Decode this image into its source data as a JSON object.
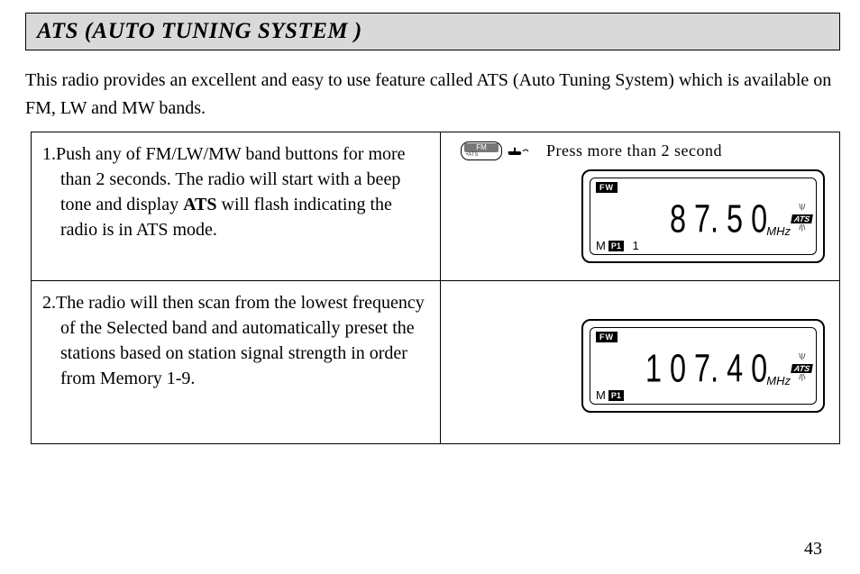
{
  "title": "ATS (AUTO TUNING SYSTEM )",
  "intro": "This radio provides an excellent and easy to use feature called ATS (Auto Tuning System) which is available on FM, LW and MW bands.",
  "steps": [
    {
      "num": "1.",
      "before_bold": "Push any of FM/LW/MW band buttons for more than 2 seconds. The radio will start with a beep tone and display ",
      "bold": "ATS",
      "after_bold": " will flash indicating the radio is in ATS mode."
    },
    {
      "num": "2.",
      "before_bold": "The radio will then scan from the lowest fre­quency of the Selected band and automatically preset the stations based on station signal strength in order from Memory 1-9.",
      "bold": "",
      "after_bold": ""
    }
  ],
  "button": {
    "main": "FM",
    "sub": "•ATS"
  },
  "press_label": "Press more than 2 second",
  "lcd": [
    {
      "fw": "FW",
      "m": "M",
      "p1": "P1",
      "preset": "1",
      "freq": "8 7. 5 0",
      "unit": "MHz",
      "ats": "ATS"
    },
    {
      "fw": "FW",
      "m": "M",
      "p1": "P1",
      "preset": "",
      "freq": "1 0 7. 4 0",
      "unit": "MHz",
      "ats": "ATS"
    }
  ],
  "page_number": "43"
}
